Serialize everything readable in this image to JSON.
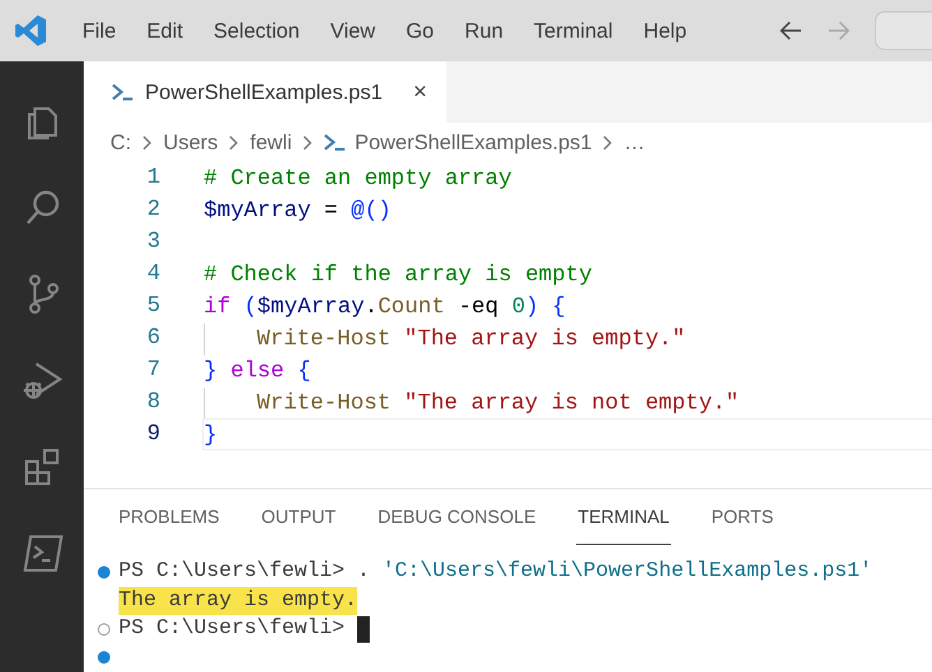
{
  "menu": [
    "File",
    "Edit",
    "Selection",
    "View",
    "Go",
    "Run",
    "Terminal",
    "Help"
  ],
  "activity_bar": [
    {
      "kind": "files",
      "selected": false
    },
    {
      "kind": "search",
      "selected": false
    },
    {
      "kind": "source-control",
      "selected": false
    },
    {
      "kind": "run-debug",
      "selected": false
    },
    {
      "kind": "extensions",
      "selected": false
    },
    {
      "kind": "terminal",
      "selected": false
    }
  ],
  "tabs": [
    {
      "label": "PowerShellExamples.ps1",
      "close": "×",
      "selected": true
    }
  ],
  "breadcrumb": [
    {
      "label": "C:",
      "kind": "folder"
    },
    {
      "label": "Users",
      "kind": "folder"
    },
    {
      "label": "fewli",
      "kind": "folder"
    },
    {
      "label": "PowerShellExamples.ps1",
      "kind": "file"
    },
    {
      "label": "…",
      "kind": "symbol"
    }
  ],
  "code": [
    {
      "number": "1",
      "current": false,
      "indented": false,
      "tokens": [
        {
          "kind": "comment",
          "text": "# Create an empty array"
        }
      ]
    },
    {
      "number": "2",
      "current": false,
      "indented": false,
      "tokens": [
        {
          "kind": "variable",
          "text": "$myArray"
        },
        {
          "kind": "plain",
          "text": " = "
        },
        {
          "kind": "operator",
          "text": "@()"
        }
      ]
    },
    {
      "number": "3",
      "current": false,
      "indented": false
    },
    {
      "number": "4",
      "current": false,
      "indented": false,
      "tokens": [
        {
          "kind": "comment",
          "text": "# Check if the array is empty"
        }
      ]
    },
    {
      "number": "5",
      "current": false,
      "indented": false,
      "tokens": [
        {
          "kind": "keyword",
          "text": "if"
        },
        {
          "kind": "operator",
          "text": " ("
        },
        {
          "kind": "variable",
          "text": "$myArray"
        },
        {
          "kind": "plain",
          "text": "."
        },
        {
          "kind": "command",
          "text": "Count"
        },
        {
          "kind": "plain",
          "text": " -eq "
        },
        {
          "kind": "number",
          "text": "0"
        },
        {
          "kind": "operator",
          "text": ") {"
        }
      ]
    },
    {
      "number": "6",
      "current": false,
      "indented": true,
      "tokens": [
        {
          "kind": "command",
          "text": "Write-Host"
        },
        {
          "kind": "string",
          "text": " \"The array is empty.\""
        }
      ]
    },
    {
      "number": "7",
      "current": false,
      "indented": false,
      "tokens": [
        {
          "kind": "operator",
          "text": "}"
        },
        {
          "kind": "keyword",
          "text": " else"
        },
        {
          "kind": "operator",
          "text": " {"
        }
      ]
    },
    {
      "number": "8",
      "current": false,
      "indented": true,
      "tokens": [
        {
          "kind": "command",
          "text": "Write-Host"
        },
        {
          "kind": "string",
          "text": " \"The array is not empty.\""
        }
      ]
    },
    {
      "number": "9",
      "current": true,
      "indented": false,
      "tokens": [
        {
          "kind": "operator",
          "text": "}"
        }
      ]
    }
  ],
  "panel_tabs": [
    {
      "label": "PROBLEMS",
      "selected": false
    },
    {
      "label": "OUTPUT",
      "selected": false
    },
    {
      "label": "DEBUG CONSOLE",
      "selected": false
    },
    {
      "label": "TERMINAL",
      "selected": true
    },
    {
      "label": "PORTS",
      "selected": false
    }
  ],
  "terminal": [
    {
      "kind": "command",
      "highlighted": false,
      "cursor": false,
      "segments": [
        {
          "kind": "plain",
          "text": "PS C:\\Users\\fewli> . "
        },
        {
          "kind": "string",
          "text": "'C:\\Users\\fewli\\PowerShellExamples.ps1'"
        }
      ]
    },
    {
      "kind": "output",
      "highlighted": true,
      "cursor": false,
      "segments": [
        {
          "kind": "plain",
          "text": "The array is empty."
        }
      ]
    },
    {
      "kind": "prompt",
      "highlighted": false,
      "cursor": true,
      "segments": [
        {
          "kind": "plain",
          "text": "PS C:\\Users\\fewli>"
        }
      ]
    },
    {
      "kind": "command"
    }
  ]
}
